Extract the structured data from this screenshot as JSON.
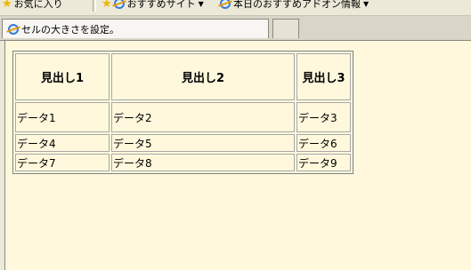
{
  "favorites_bar": {
    "items": [
      {
        "label": "お気に入り",
        "icon": "star-icon"
      },
      {
        "label": "おすすめサイト",
        "icon": "ie-icon"
      },
      {
        "label": "本日のおすすめアドオン情報",
        "icon": "ie-icon"
      }
    ]
  },
  "tabs": [
    {
      "title": "セルの大きさを設定。",
      "icon": "ie-icon"
    }
  ],
  "table": {
    "headers": [
      "見出し1",
      "見出し2",
      "見出し3"
    ],
    "rows": [
      [
        "データ1",
        "データ2",
        "データ3"
      ],
      [
        "データ4",
        "データ5",
        "データ6"
      ],
      [
        "データ7",
        "データ8",
        "データ9"
      ]
    ]
  },
  "colors": {
    "page_background": "#fff8dc",
    "chrome": "#ece9d8",
    "border": "#a8a8a8"
  }
}
